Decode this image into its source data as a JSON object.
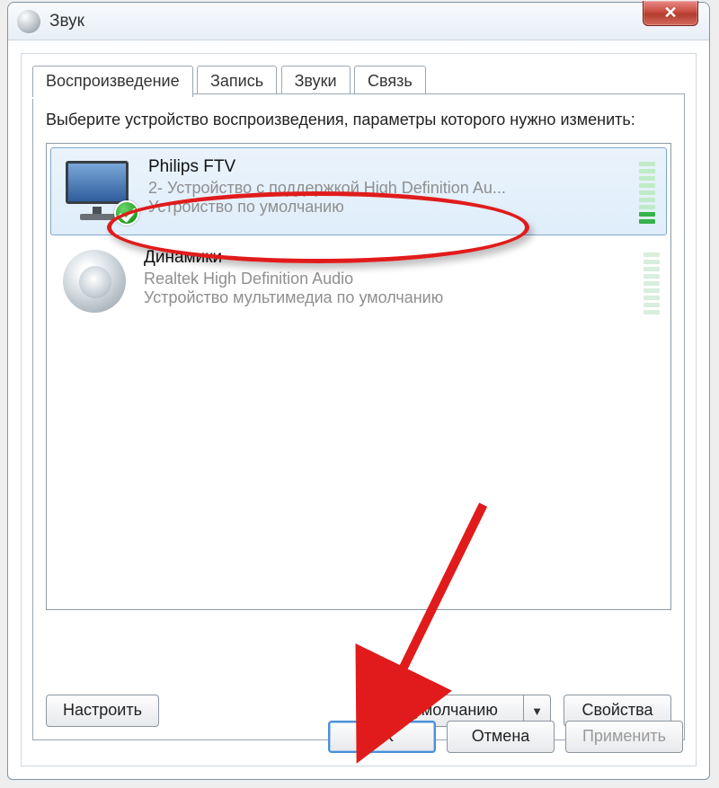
{
  "window": {
    "title": "Звук"
  },
  "tabs": [
    {
      "label": "Воспроизведение",
      "active": true
    },
    {
      "label": "Запись",
      "active": false
    },
    {
      "label": "Звуки",
      "active": false
    },
    {
      "label": "Связь",
      "active": false
    }
  ],
  "instruction": "Выберите устройство воспроизведения, параметры которого нужно изменить:",
  "devices": [
    {
      "name": "Philips FTV",
      "line2": "2- Устройство с поддержкой High Definition Au...",
      "line3": "Устройство по умолчанию",
      "selected": true,
      "default_check": true,
      "icon": "monitor",
      "vu_filled": 2
    },
    {
      "name": "Динамики",
      "line2": "Realtek High Definition Audio",
      "line3": "Устройство мультимедиа по умолчанию",
      "selected": false,
      "default_check": false,
      "icon": "speaker",
      "vu_filled": 0
    }
  ],
  "buttons": {
    "configure": "Настроить",
    "set_default": "По умолчанию",
    "properties": "Свойства",
    "ok": "OK",
    "cancel": "Отмена",
    "apply": "Применить"
  }
}
